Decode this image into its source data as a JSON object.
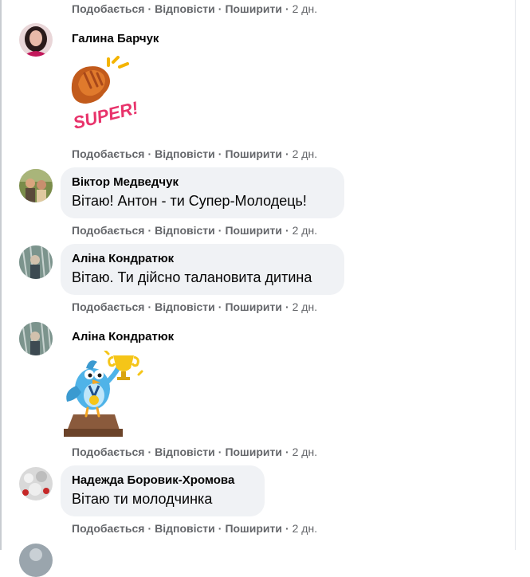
{
  "actions": {
    "like": "Подобається",
    "reply": "Відповісти",
    "share": "Поширити",
    "sep": "·",
    "time": "2 дн."
  },
  "comments": [
    {
      "author": "Галина Барчук",
      "sticker": "super-clap-sticker",
      "sticker_text": "SUPER!"
    },
    {
      "author": "Віктор Медведчук",
      "text": "Вітаю! Антон - ти Супер-Молодець!"
    },
    {
      "author": "Аліна Кондратюк",
      "text": "Вітаю. Ти дійсно талановита дитина"
    },
    {
      "author": "Аліна Кондратюк",
      "sticker": "bird-trophy-sticker"
    },
    {
      "author": "Надежда Боровик-Хромова",
      "text": "Вітаю ти молодчинка"
    }
  ],
  "colors": {
    "bubble": "#f0f2f5",
    "meta_text": "#65676b",
    "name_text": "#050505"
  }
}
